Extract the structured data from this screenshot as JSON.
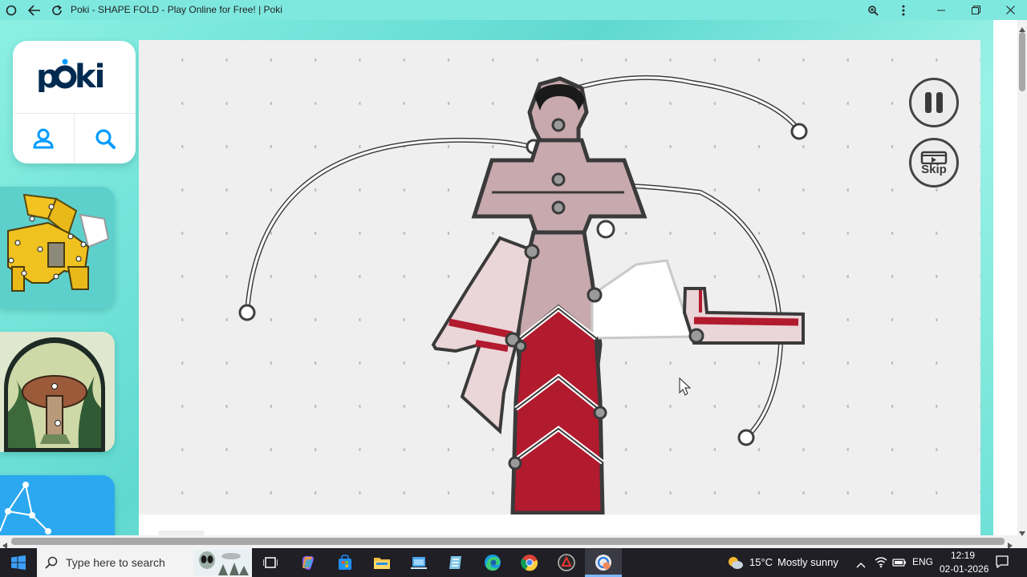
{
  "titlebar": {
    "title": "Poki - SHAPE FOLD - Play Online for Free! | Poki",
    "icons": [
      "circle-menu-icon",
      "back-arrow-icon",
      "reload-icon",
      "zoom-icon",
      "more-vertical-icon",
      "minimize-icon",
      "maximize-icon",
      "close-icon"
    ]
  },
  "sidebar": {
    "logo": "poki",
    "buttons": [
      "user-icon",
      "search-icon"
    ],
    "game_thumbs": [
      "lion-puzzle-game",
      "mushroom-window-game",
      "constellation-game"
    ]
  },
  "game": {
    "title": "SHAPE FOLD",
    "pause_icon": "pause-icon",
    "skip_label": "Skip",
    "background": "#efefef",
    "accent_red": "#b21a2e",
    "piece_pink": "#c8a9ad"
  },
  "taskbar": {
    "search_placeholder": "Type here to search",
    "weather_temp": "15°C",
    "weather_desc": "Mostly sunny",
    "language": "ENG",
    "time": "12:19",
    "date": "02-01-2026",
    "apps": [
      "start-icon",
      "task-view-icon",
      "copilot-icon",
      "store-icon",
      "file-explorer-icon",
      "files-icon",
      "notepad-icon",
      "edge-icon",
      "chrome-icon",
      "media-icon",
      "chrome-active-icon"
    ]
  },
  "colors": {
    "chrome_bg": "#7ee8df",
    "taskbar_bg": "#1f1f25",
    "poki_navy": "#002b50",
    "poki_blue": "#009cff"
  }
}
